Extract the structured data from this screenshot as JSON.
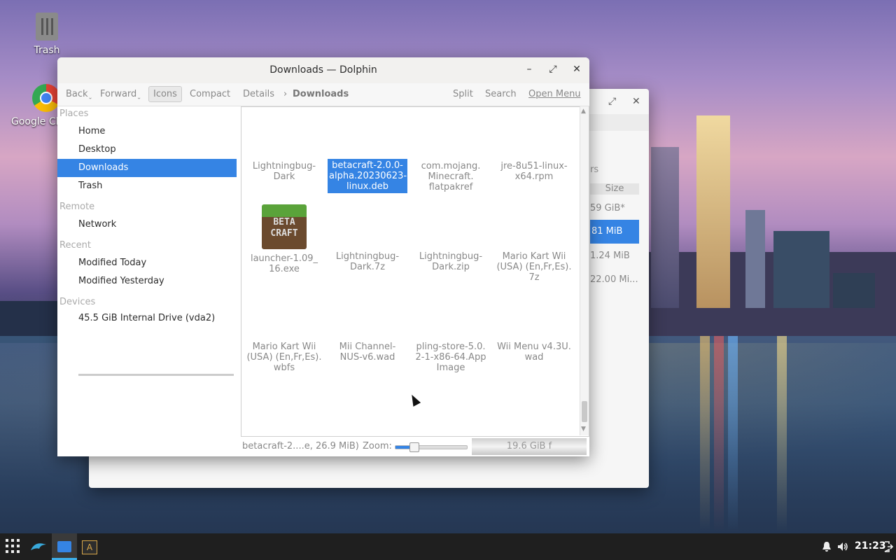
{
  "desktop": {
    "icons": [
      {
        "label": "Trash"
      },
      {
        "label": "Google Chrome"
      }
    ]
  },
  "bg_window": {
    "partial_header": "rs",
    "size_header": "Size",
    "sizes": [
      "59 GiB*",
      "81 MiB",
      "1.24 MiB",
      "22.00 Mi..."
    ]
  },
  "window": {
    "title": "Downloads — Dolphin",
    "minimize": "–",
    "maximize": "⤢",
    "close": "✕"
  },
  "toolbar": {
    "back": "Back",
    "forward": "Forward",
    "icons": "Icons",
    "compact": "Compact",
    "details": "Details",
    "breadcrumb_sep": "›",
    "location": "Downloads",
    "split": "Split",
    "search": "Search",
    "open_menu": "Open Menu"
  },
  "sidebar": {
    "places_header": "Places",
    "places": [
      "Home",
      "Desktop",
      "Downloads",
      "Trash"
    ],
    "selected": "Downloads",
    "remote_header": "Remote",
    "remote": [
      "Network"
    ],
    "recent_header": "Recent",
    "recent": [
      "Modified Today",
      "Modified Yesterday"
    ],
    "devices_header": "Devices",
    "devices": [
      "45.5 GiB Internal Drive (vda2)"
    ]
  },
  "files": [
    "Lightningbug-Dark",
    "betacraft-2.0.0-alpha.20230623-linux.deb",
    "com.mojang.Minecraft.flatpakref",
    "jre-8u51-linux-x64.rpm",
    "launcher-1.09_16.exe",
    "Lightningbug-Dark.7z",
    "Lightningbug-Dark.zip",
    "Mario Kart Wii (USA) (En,Fr,Es).7z",
    "Mario Kart Wii (USA) (En,Fr,Es).wbfs",
    "Mii Channel-NUS-v6.wad",
    "pling-store-5.0.2-1-x86-64.AppImage",
    "Wii Menu v4.3U.wad"
  ],
  "file_labels": {
    "f0": [
      "Lightningbug-",
      "Dark"
    ],
    "f1": [
      "betacraft-2.0.0-",
      "alpha.20230623-",
      "linux.deb"
    ],
    "f2": [
      "com.mojang.",
      "Minecraft.",
      "flatpakref"
    ],
    "f3": [
      "jre-8u51-linux-",
      "x64.rpm"
    ],
    "f4": [
      "launcher-1.09_",
      "16.exe"
    ],
    "f5": [
      "Lightningbug-",
      "Dark.7z"
    ],
    "f6": [
      "Lightningbug-",
      "Dark.zip"
    ],
    "f7": [
      "Mario Kart Wii",
      "(USA) (En,Fr,Es).",
      "7z"
    ],
    "f8": [
      "Mario Kart Wii",
      "(USA) (En,Fr,Es).",
      "wbfs"
    ],
    "f9": [
      "Mii Channel-",
      "NUS-v6.wad"
    ],
    "f10": [
      "pling-store-5.0.",
      "2-1-x86-64.App",
      "Image"
    ],
    "f11": [
      "Wii Menu v4.3U.",
      "wad"
    ]
  },
  "launcher_thumb_text": [
    "BETA",
    "CRAFT"
  ],
  "status": {
    "selection": "betacraft-2....e, 26.9 MiB)",
    "zoom_label": "Zoom:",
    "zoom_value": 0.25,
    "free_space": "19.6 GiB f"
  },
  "taskbar": {
    "time": "21:23"
  },
  "colors": {
    "accent": "#3584e4"
  }
}
